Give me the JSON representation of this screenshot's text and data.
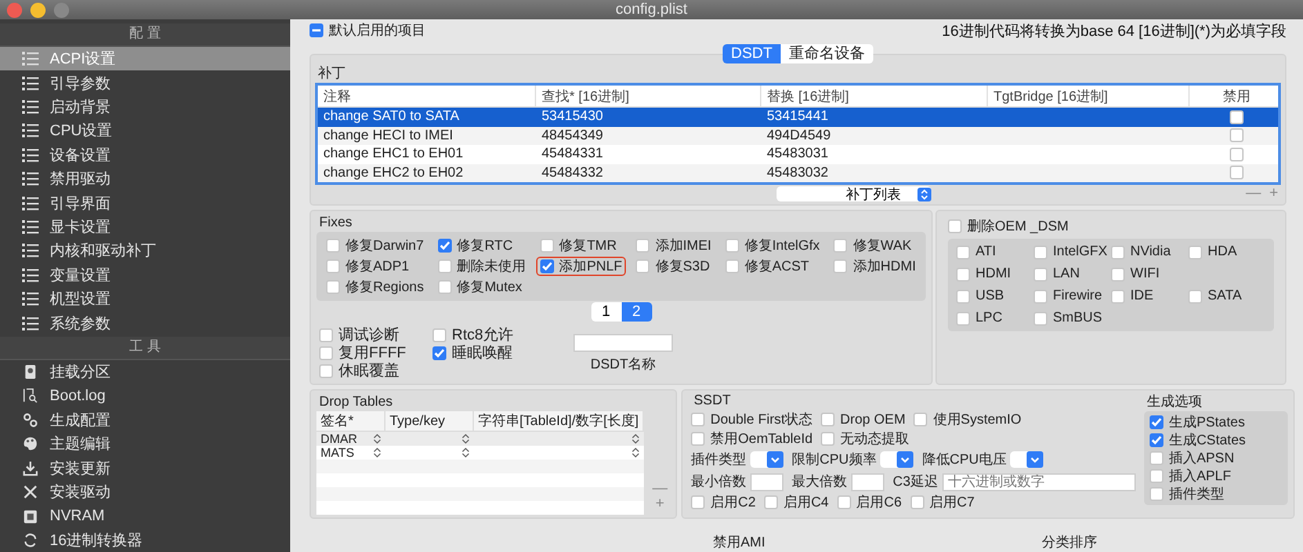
{
  "window": {
    "title": "config.plist"
  },
  "sidebar": {
    "sections": [
      {
        "title": "配 置",
        "items": [
          {
            "label": "ACPI设置",
            "kind": "list",
            "selected": true
          },
          {
            "label": "引导参数",
            "kind": "list",
            "selected": false
          },
          {
            "label": "启动背景",
            "kind": "list",
            "selected": false
          },
          {
            "label": "CPU设置",
            "kind": "list",
            "selected": false
          },
          {
            "label": "设备设置",
            "kind": "list",
            "selected": false
          },
          {
            "label": "禁用驱动",
            "kind": "list",
            "selected": false
          },
          {
            "label": "引导界面",
            "kind": "list",
            "selected": false
          },
          {
            "label": "显卡设置",
            "kind": "list",
            "selected": false
          },
          {
            "label": "内核和驱动补丁",
            "kind": "list",
            "selected": false
          },
          {
            "label": "变量设置",
            "kind": "list",
            "selected": false
          },
          {
            "label": "机型设置",
            "kind": "list",
            "selected": false
          },
          {
            "label": "系统参数",
            "kind": "list",
            "selected": false
          }
        ]
      },
      {
        "title": "工 具",
        "items": [
          {
            "label": "挂载分区",
            "kind": "disk",
            "selected": false
          },
          {
            "label": "Boot.log",
            "kind": "log",
            "selected": false
          },
          {
            "label": "生成配置",
            "kind": "gears",
            "selected": false
          },
          {
            "label": "主题编辑",
            "kind": "palette",
            "selected": false
          },
          {
            "label": "安装更新",
            "kind": "download",
            "selected": false
          },
          {
            "label": "安装驱动",
            "kind": "tools",
            "selected": false
          },
          {
            "label": "NVRAM",
            "kind": "chip",
            "selected": false
          },
          {
            "label": "16进制转换器",
            "kind": "convert",
            "selected": false
          }
        ]
      }
    ]
  },
  "default_enabled": {
    "label": "默认启用的项目",
    "mixed": true
  },
  "hint": "16进制代码将转换为base 64 [16进制](*)为必填字段",
  "segments": [
    {
      "label": "DSDT",
      "selected": true
    },
    {
      "label": "重命名设备",
      "selected": false
    }
  ],
  "patches": {
    "title": "补丁",
    "columns": [
      "注释",
      "查找* [16进制]",
      "替换 [16进制]",
      "TgtBridge [16进制]",
      "禁用"
    ],
    "rows": [
      {
        "comment": "change SAT0 to SATA",
        "find": "53415430",
        "replace": "53415441",
        "disabled": false,
        "selected": true
      },
      {
        "comment": "change HECI to IMEI",
        "find": "48454349",
        "replace": "494D4549",
        "disabled": false,
        "selected": false
      },
      {
        "comment": "change EHC1 to EH01",
        "find": "45484331",
        "replace": "45483031",
        "disabled": false,
        "selected": false
      },
      {
        "comment": "change EHC2 to EH02",
        "find": "45484332",
        "replace": "45483032",
        "disabled": false,
        "selected": false
      }
    ],
    "list_popup": "补丁列表",
    "remove": "—",
    "add": "+"
  },
  "fixes": {
    "title": "Fixes",
    "items": [
      {
        "label": "修复Darwin7",
        "checked": false,
        "highlighted": false
      },
      {
        "label": "修复RTC",
        "checked": true,
        "highlighted": false
      },
      {
        "label": "修复TMR",
        "checked": false,
        "highlighted": false
      },
      {
        "label": "添加IMEI",
        "checked": false,
        "highlighted": false
      },
      {
        "label": "修复IntelGfx",
        "checked": false,
        "highlighted": false
      },
      {
        "label": "修复WAK",
        "checked": false,
        "highlighted": false
      },
      {
        "label": "修复ADP1",
        "checked": false,
        "highlighted": false
      },
      {
        "label": "删除未使用",
        "checked": false,
        "highlighted": false
      },
      {
        "label": "添加PNLF",
        "checked": true,
        "highlighted": true
      },
      {
        "label": "修复S3D",
        "checked": false,
        "highlighted": false
      },
      {
        "label": "修复ACST",
        "checked": false,
        "highlighted": false
      },
      {
        "label": "添加HDMI",
        "checked": false,
        "highlighted": false
      },
      {
        "label": "修复Regions",
        "checked": false,
        "highlighted": false
      },
      {
        "label": "修复Mutex",
        "checked": false,
        "highlighted": false
      }
    ],
    "pages": [
      {
        "label": "1",
        "selected": false
      },
      {
        "label": "2",
        "selected": true
      }
    ]
  },
  "options": [
    {
      "label": "调试诊断",
      "checked": false
    },
    {
      "label": "复用FFFF",
      "checked": false
    },
    {
      "label": "休眠覆盖",
      "checked": false
    },
    {
      "label": "Rtc8允许",
      "checked": false
    },
    {
      "label": "睡眠唤醒",
      "checked": true
    }
  ],
  "dsdt_name": {
    "label": "DSDT名称"
  },
  "drop_oem": {
    "label": "删除OEM _DSM",
    "checked": false,
    "rows": [
      [
        {
          "label": "ATI",
          "checked": false
        },
        {
          "label": "IntelGFX",
          "checked": false
        },
        {
          "label": "NVidia",
          "checked": false
        },
        {
          "label": "HDA",
          "checked": false
        }
      ],
      [
        {
          "label": "HDMI",
          "checked": false
        },
        {
          "label": "LAN",
          "checked": false
        },
        {
          "label": "WIFI",
          "checked": false
        }
      ],
      [
        {
          "label": "USB",
          "checked": false
        },
        {
          "label": "Firewire",
          "checked": false
        },
        {
          "label": "IDE",
          "checked": false
        },
        {
          "label": "SATA",
          "checked": false
        }
      ],
      [
        {
          "label": "LPC",
          "checked": false
        },
        {
          "label": "SmBUS",
          "checked": false
        }
      ]
    ]
  },
  "drop_tables": {
    "title": "Drop Tables",
    "columns": [
      "签名*",
      "Type/key",
      "字符串[TableId]/数字[长度]"
    ],
    "rows": [
      {
        "signature": "DMAR"
      },
      {
        "signature": "MATS"
      }
    ],
    "remove": "—",
    "add": "+"
  },
  "ssdt": {
    "title": "SSDT",
    "flags": [
      {
        "label": "Double First状态",
        "checked": false
      },
      {
        "label": "Drop OEM",
        "checked": false
      },
      {
        "label": "使用SystemIO",
        "checked": false
      },
      {
        "label": "禁用OemTableId",
        "checked": false
      },
      {
        "label": "无动态提取",
        "checked": false
      }
    ],
    "selects": [
      {
        "label": "插件类型"
      },
      {
        "label": "限制CPU频率"
      },
      {
        "label": "降低CPU电压"
      }
    ],
    "fields": [
      {
        "label": "最小倍数",
        "kind": "short"
      },
      {
        "label": "最大倍数",
        "kind": "short"
      },
      {
        "label": "C3延迟",
        "kind": "wide",
        "placeholder": "十六进制或数字"
      }
    ],
    "c_states": [
      {
        "label": "启用C2",
        "checked": false
      },
      {
        "label": "启用C4",
        "checked": false
      },
      {
        "label": "启用C6",
        "checked": false
      },
      {
        "label": "启用C7",
        "checked": false
      }
    ],
    "generate": {
      "title": "生成选项",
      "items": [
        {
          "label": "生成PStates",
          "checked": true
        },
        {
          "label": "生成CStates",
          "checked": true
        },
        {
          "label": "插入APSN",
          "checked": false
        },
        {
          "label": "插入APLF",
          "checked": false
        },
        {
          "label": "插件类型",
          "checked": false
        }
      ]
    }
  },
  "footer_labels": [
    "禁用AMI",
    "分类排序"
  ]
}
